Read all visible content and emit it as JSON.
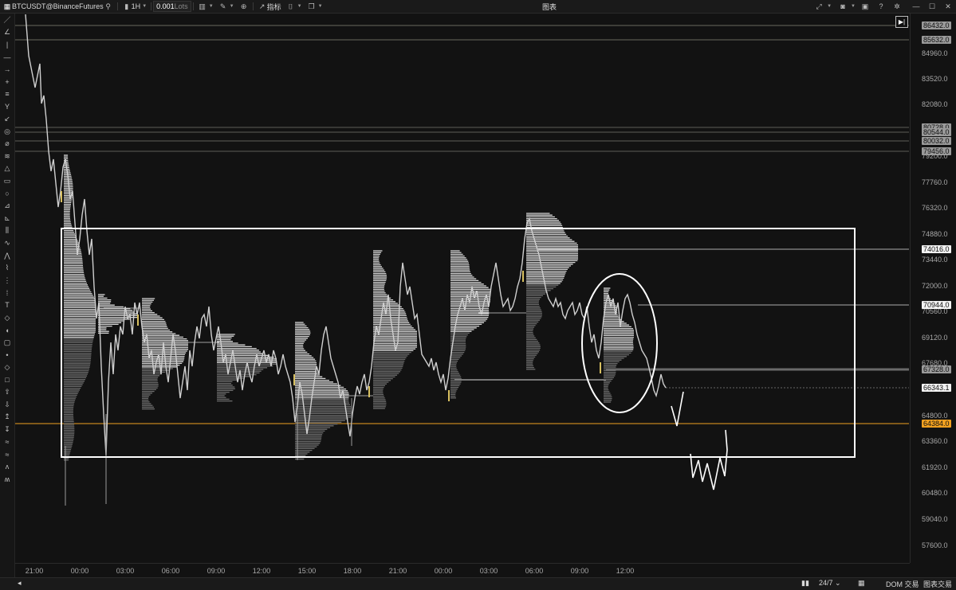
{
  "window": {
    "title": "图表"
  },
  "toolbar": {
    "symbol": "BTCUSDT@BinanceFutures",
    "timeframe": "1H",
    "quantity": "0.001",
    "quantity_unit": "Lots",
    "indicators_label": "指标"
  },
  "left_tools": [
    "line-tool-icon",
    "fib-tool-icon",
    "vline-tool-icon",
    "hline-tool-icon",
    "arrow-tool-icon",
    "crosshair-tool-icon",
    "parallel-channel-icon",
    "pitchfork-icon",
    "trend-angle-icon",
    "cycle-icon",
    "ruler-icon",
    "fib-ext-icon",
    "triangle-icon",
    "rectangle-icon",
    "ellipse-icon",
    "fan-icon",
    "fib-fan-icon",
    "volume-profile-icon",
    "wave-icon",
    "pattern-icon",
    "zigzag-icon",
    "grid-icon",
    "dotted-grid-icon",
    "text-icon",
    "label-icon",
    "callout-icon",
    "note-icon",
    "dot-icon",
    "diamond-icon",
    "square-icon",
    "arrow-up-icon",
    "arrow-down-icon",
    "long-position-icon",
    "short-position-icon",
    "elliott-icon",
    "elliott2-icon",
    "abcd-icon",
    "xabcd-icon"
  ],
  "price_axis": {
    "ticks": [
      "84960.0",
      "83520.0",
      "82080.0",
      "79200.0",
      "77760.0",
      "76320.0",
      "74880.0",
      "73440.0",
      "72000.0",
      "70560.0",
      "69120.0",
      "67680.0",
      "64800.0",
      "63360.0",
      "61920.0",
      "60480.0",
      "59040.0",
      "57600.0"
    ],
    "level_labels": [
      {
        "text": "86432.0",
        "style": "gray"
      },
      {
        "text": "85632.0",
        "style": "gray"
      },
      {
        "text": "80728.0",
        "style": "gray"
      },
      {
        "text": "80544.0",
        "style": "gray"
      },
      {
        "text": "80032.0",
        "style": "gray"
      },
      {
        "text": "79456.0",
        "style": "gray"
      },
      {
        "text": "74016.0",
        "style": "white"
      },
      {
        "text": "70944.0",
        "style": "white"
      },
      {
        "text": "67328.0",
        "style": "gray"
      },
      {
        "text": "66343.1",
        "style": "white"
      },
      {
        "text": "64384.0",
        "style": "orange"
      }
    ]
  },
  "time_axis": {
    "ticks": [
      "21:00",
      "00:00",
      "03:00",
      "06:00",
      "09:00",
      "12:00",
      "15:00",
      "18:00",
      "21:00",
      "00:00",
      "03:00",
      "06:00",
      "09:00",
      "12:00"
    ]
  },
  "bottom": {
    "session": "24/7",
    "dom_trading": "DOM 交易",
    "chart_trading": "图表交易"
  },
  "colors": {
    "background": "#121212",
    "price_line": "#cfcfcf",
    "profile_light": "#d9d9d9",
    "profile_dark": "#6e6e6e",
    "orange_level": "#f0a020",
    "box": "#ffffff"
  }
}
